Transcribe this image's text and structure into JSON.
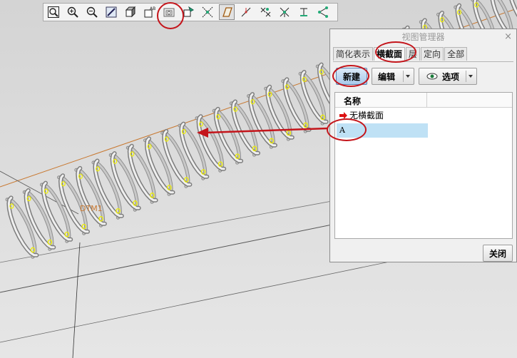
{
  "viewport": {
    "datum_label": "DTM1",
    "colors": {
      "spring": "#c8c8c8",
      "marker": "#f0f000",
      "axis": "#c87830",
      "annotation": "#c4151b"
    }
  },
  "toolbar": {
    "icons": [
      "zoom-fit-icon",
      "zoom-in-icon",
      "zoom-out-icon",
      "repaint-icon",
      "shading-icon",
      "annotation-display-icon",
      "saved-views-icon",
      "orient-icon",
      "datum-planes-icon",
      "datum-plane-display-icon",
      "datum-axes-icon",
      "datum-points-icon",
      "csys-icon",
      "spin-center-icon",
      "annotations-icon"
    ]
  },
  "dialog": {
    "title": "视图管理器",
    "close_glyph": "×",
    "tabs": [
      "简化表示",
      "横截面",
      "层",
      "定向",
      "全部"
    ],
    "active_tab": "横截面",
    "buttons": {
      "new": "新建",
      "edit": "编辑",
      "options": "选项",
      "close": "关闭"
    },
    "list": {
      "column_name": "名称",
      "items": [
        {
          "label": "无横截面",
          "active": true
        },
        {
          "label": "A",
          "selected": true
        }
      ]
    }
  }
}
